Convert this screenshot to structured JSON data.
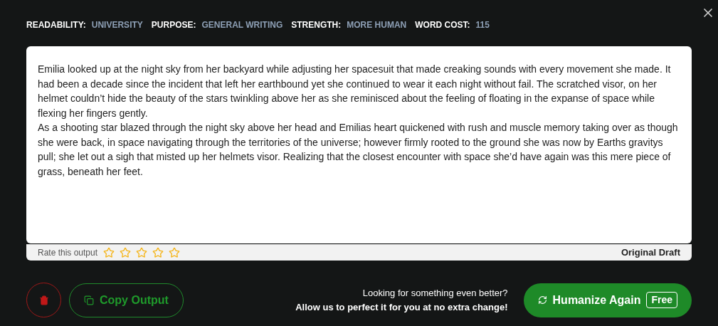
{
  "stats": [
    {
      "label": "READABILITY:",
      "value": "UNIVERSITY"
    },
    {
      "label": "PURPOSE:",
      "value": "GENERAL WRITING"
    },
    {
      "label": "STRENGTH:",
      "value": "MORE HUMAN"
    },
    {
      "label": "WORD COST:",
      "value": "115"
    }
  ],
  "output": {
    "paragraphs": [
      "Emilia looked up at the night sky from her backyard while adjusting her spacesuit that made creaking sounds with every movement she made. It had been a decade since the incident that left her earthbound yet she continued to wear it each night without fail. The scratched visor, on her helmet couldn’t hide the beauty of the stars twinkling above her as she reminisced about the feeling of floating in the expanse of space while flexing her fingers gently.",
      "As a shooting star blazed through the night sky above her head and Emilias heart quickened with rush and muscle memory taking over as though she were back, in space navigating through the territories of the universe; however firmly rooted to the ground she was now by Earths gravitys pull; she let out a sigh that misted up her helmets visor. Realizing that the closest encounter with space she’d have again was this mere piece of grass, beneath her feet."
    ]
  },
  "rating": {
    "label": "Rate this output",
    "stars": 0
  },
  "version": "Original Draft",
  "copy_button": "Copy Output",
  "promo": {
    "line1": "Looking for something even better?",
    "line2": "Allow us to perfect it for you at no extra change!"
  },
  "humanize_button": {
    "label": "Humanize Again",
    "badge": "Free"
  }
}
